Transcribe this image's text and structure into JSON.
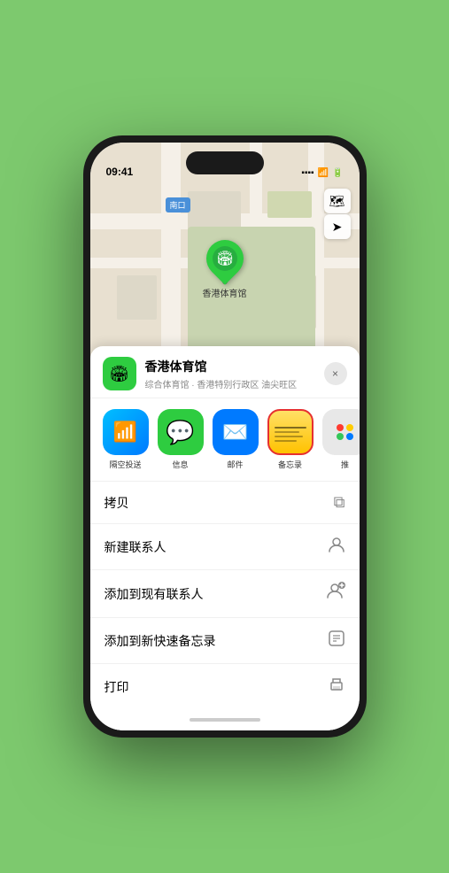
{
  "status_bar": {
    "time": "09:41",
    "signal": "●●●●",
    "wifi": "WiFi",
    "battery": "■"
  },
  "map": {
    "label": "南口",
    "pin_label": "香港体育馆",
    "map_icon": "📍"
  },
  "venue": {
    "name": "香港体育馆",
    "subtitle": "综合体育馆 · 香港特别行政区 油尖旺区",
    "icon": "🏟"
  },
  "share_apps": [
    {
      "id": "airdrop",
      "label": "隔空投送",
      "icon": "📶"
    },
    {
      "id": "message",
      "label": "信息",
      "icon": "💬"
    },
    {
      "id": "mail",
      "label": "邮件",
      "icon": "✉️"
    },
    {
      "id": "notes",
      "label": "备忘录",
      "icon": "📝"
    },
    {
      "id": "more",
      "label": "推",
      "icon": "···"
    }
  ],
  "actions": [
    {
      "id": "copy",
      "label": "拷贝",
      "icon": "⧉"
    },
    {
      "id": "new-contact",
      "label": "新建联系人",
      "icon": "👤"
    },
    {
      "id": "add-contact",
      "label": "添加到现有联系人",
      "icon": "👤+"
    },
    {
      "id": "quick-note",
      "label": "添加到新快速备忘录",
      "icon": "⊞"
    },
    {
      "id": "print",
      "label": "打印",
      "icon": "🖨"
    }
  ],
  "buttons": {
    "close": "×"
  }
}
